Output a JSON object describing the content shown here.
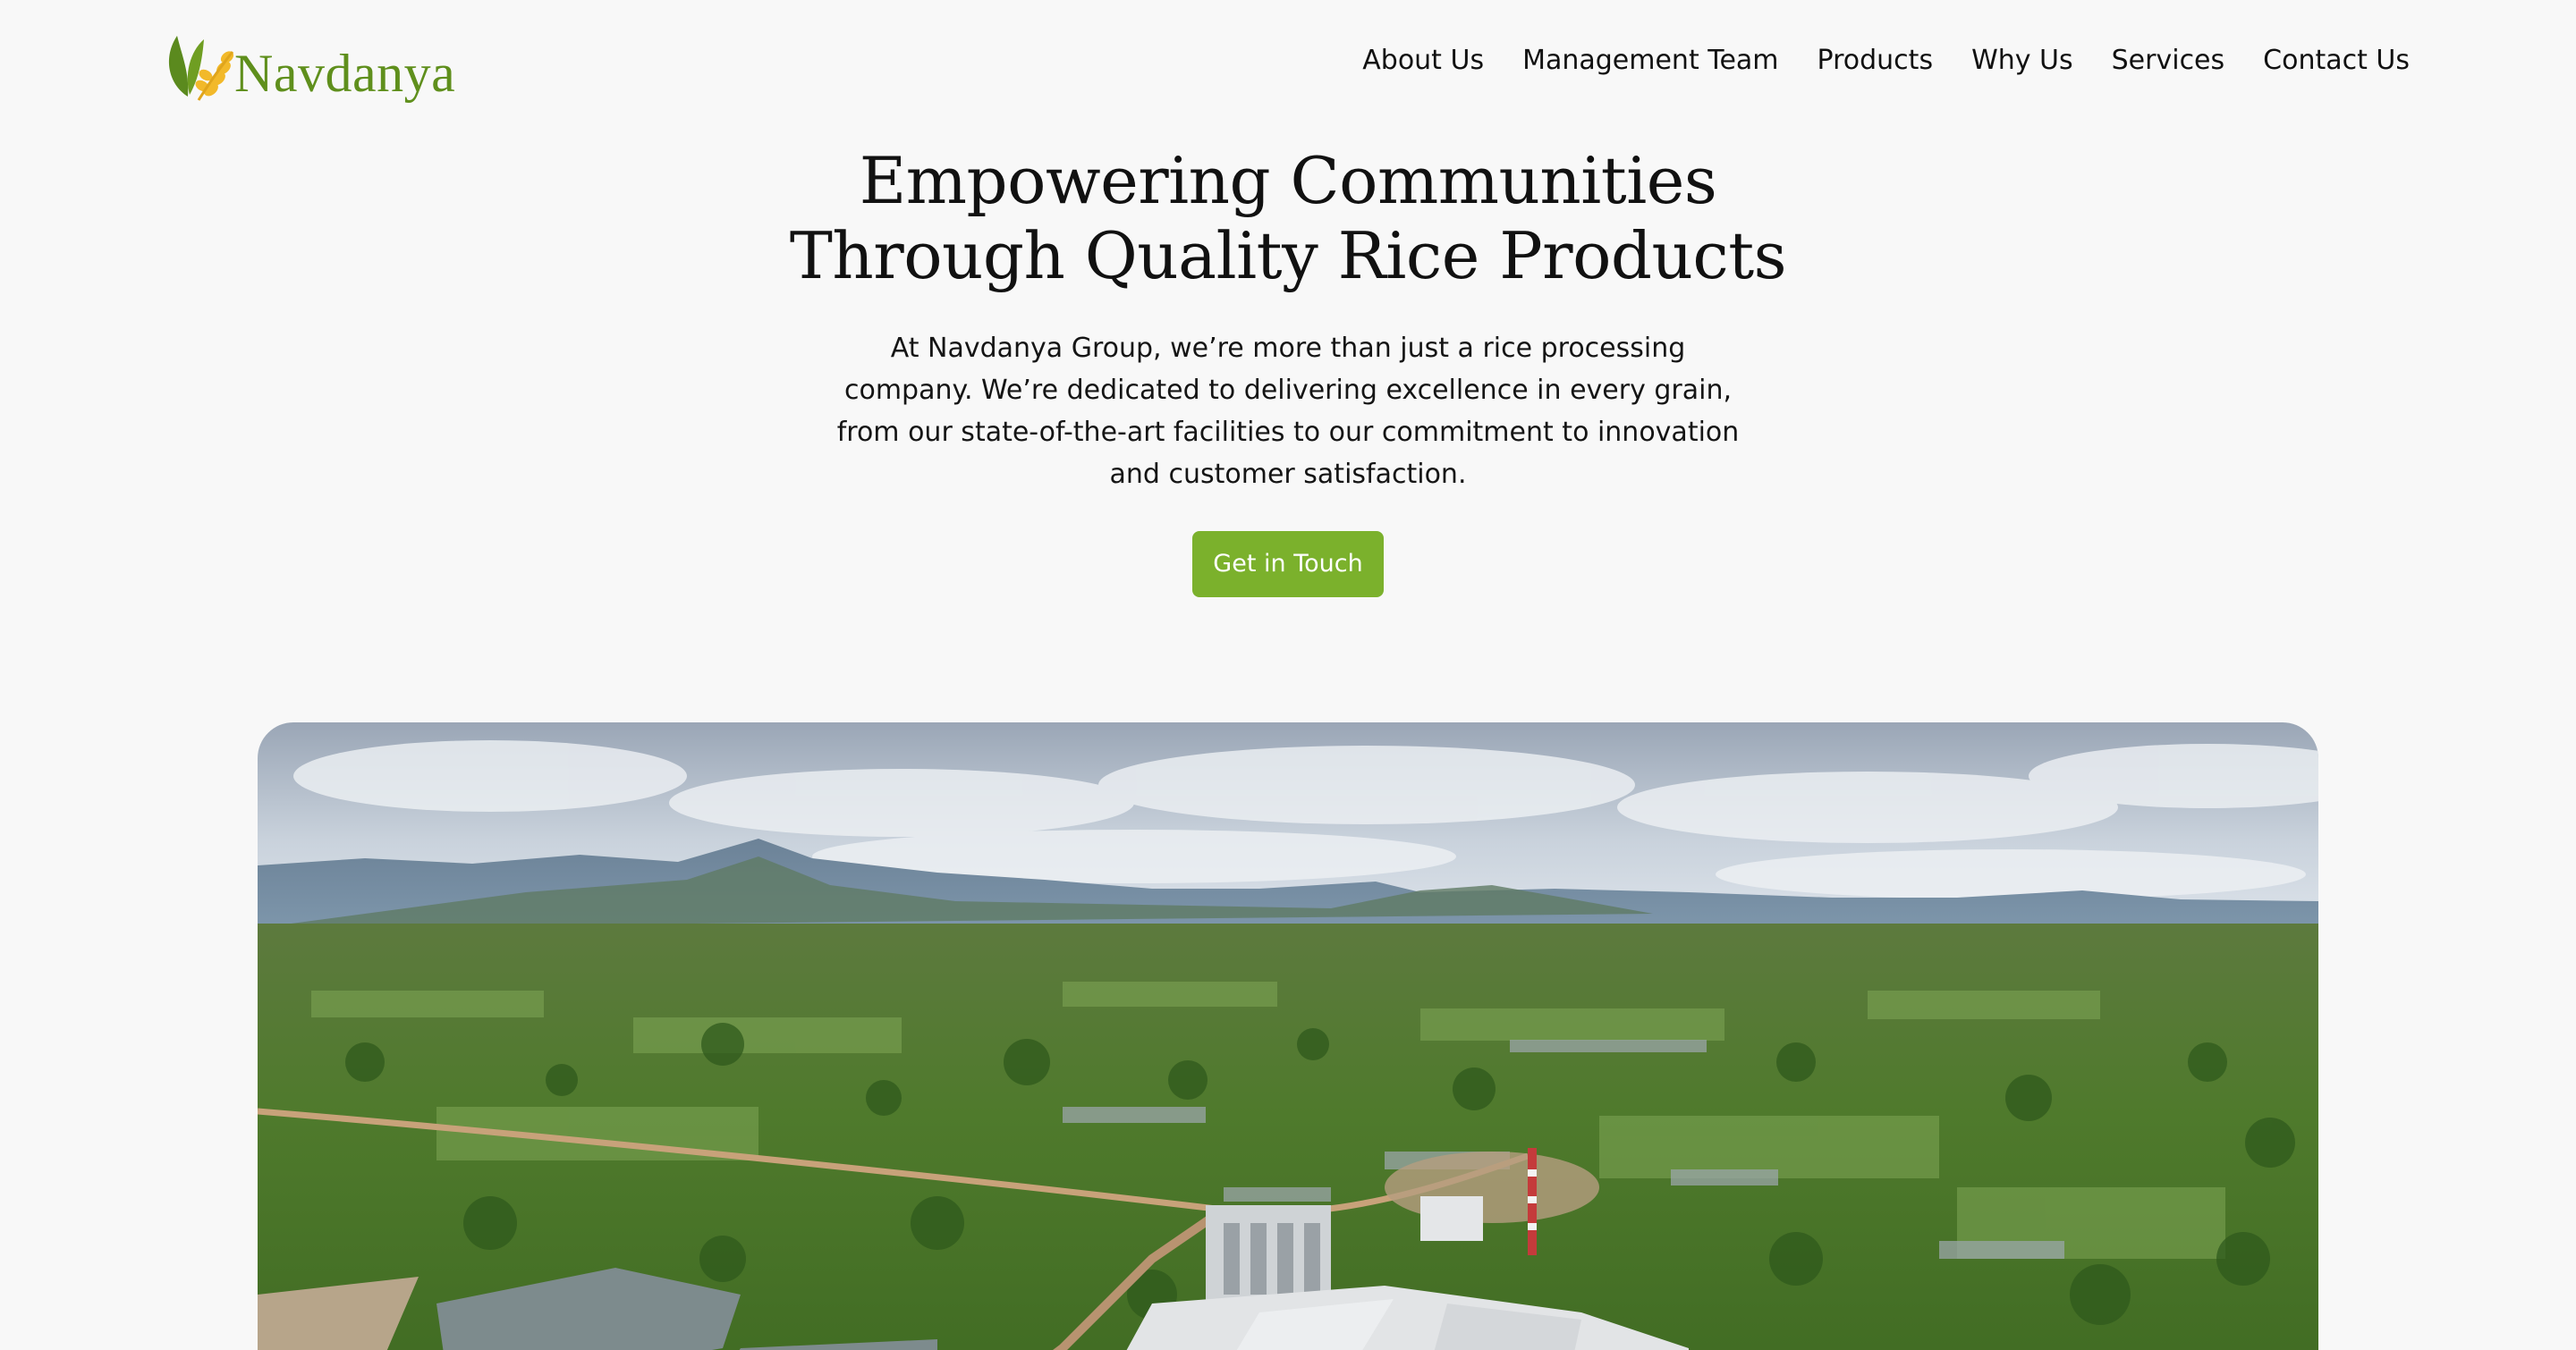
{
  "brand": {
    "name": "Navdanya",
    "color": "#5f8f1c"
  },
  "nav": {
    "items": [
      {
        "label": "About Us"
      },
      {
        "label": "Management Team"
      },
      {
        "label": "Products"
      },
      {
        "label": "Why Us"
      },
      {
        "label": "Services"
      },
      {
        "label": "Contact Us"
      }
    ]
  },
  "hero": {
    "title_line1": "Empowering Communities",
    "title_line2": "Through Quality Rice Products",
    "description": "At Navdanya Group, we’re more than just a rice processing company. We’re dedicated to delivering excellence in every grain, from our state-of-the-art facilities to our commitment to innovation and customer satisfaction.",
    "cta_label": "Get in Touch",
    "cta_color": "#7bb12c"
  }
}
